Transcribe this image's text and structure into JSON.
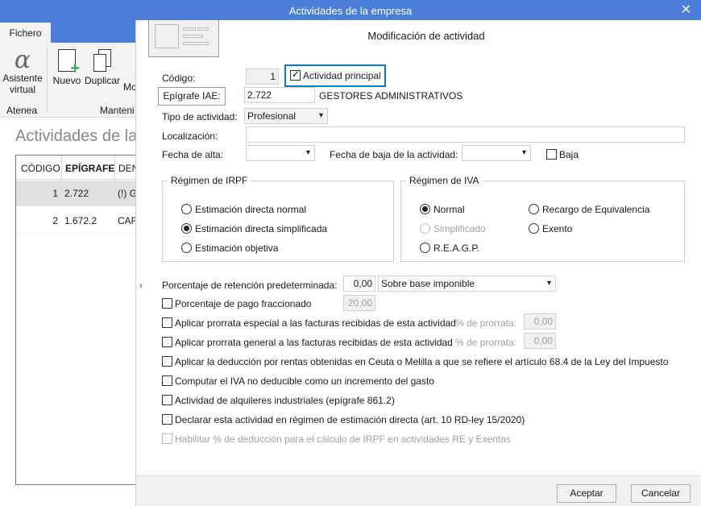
{
  "window": {
    "title": "Actividades de la empresa",
    "close": "✕"
  },
  "ribbon": {
    "tab": "Fichero",
    "asistente": "Asistente",
    "virtual": "virtual",
    "group1": "Atenea",
    "nuevo": "Nuevo",
    "duplicar": "Duplicar",
    "mod": "Mo",
    "group2": "Manteni"
  },
  "list": {
    "title": "Actividades de la",
    "headers": [
      "CÓDIGO",
      "EPÍGRAFE",
      "DEN"
    ],
    "rows": [
      {
        "codigo": "1",
        "epigrafe": "2.722",
        "den": "(!) G"
      },
      {
        "codigo": "2",
        "epigrafe": "1.672.2",
        "den": "CAF"
      }
    ]
  },
  "dialog": {
    "title": "Modificación de actividad",
    "codigo_label": "Código:",
    "codigo": "1",
    "principal": "Actividad principal",
    "principal_checked": true,
    "epigrafe_btn": "Epígrafe IAE:",
    "epigrafe": "2.722",
    "epigrafe_desc": "GESTORES ADMINISTRATIVOS",
    "tipo_label": "Tipo de actividad:",
    "tipo": "Profesional",
    "loc_label": "Localización:",
    "loc": "",
    "alta_label": "Fecha de alta:",
    "baja_label": "Fecha de baja de la actividad:",
    "baja_cb": "Baja",
    "irpf": {
      "legend": "Régimen de IRPF",
      "options": [
        "Estimación directa normal",
        "Estimación directa simplificada",
        "Estimación objetiva"
      ],
      "selected": 1
    },
    "iva": {
      "legend": "Régimen de IVA",
      "normal": "Normal",
      "simplificado": "Simplificado",
      "reagp": "R.E.A.G.P.",
      "recargo": "Recargo de Equivalencia",
      "exento": "Exento",
      "selected": "Normal"
    },
    "retencion_label": "Porcentaje de retención predeterminada:",
    "retencion": "0,00",
    "retencion_base": "Sobre base imponible",
    "fraccionado": "Porcentaje de pago fraccionado",
    "fraccionado_val": "20,00",
    "prorrata_esp": "Aplicar prorrata especial a las facturas recibidas de esta actividad",
    "prorrata_label": "% de prorrata:",
    "prorrata_esp_val": "0,00",
    "prorrata_gen": "Aplicar prorrata general a las facturas recibidas de esta actividad",
    "prorrata_gen_val": "0,00",
    "ceuta": "Aplicar la deducción por rentas obtenidas en Ceuta o Melilla a que se refiere el artículo 68.4 de la Ley del Impuesto",
    "computar": "Computar el IVA no deducible como un incremento del gasto",
    "alquileres": "Actividad de alquileres industriales (epígrafe 861.2)",
    "declarar": "Declarar esta actividad en régimen de estimación directa (art. 10 RD-ley 15/2020)",
    "habilitar": "Habilitar % de deducción para el cálculo de IRPF en actividades RE y Exentas",
    "aceptar": "Aceptar",
    "cancelar": "Cancelar"
  },
  "colors": {
    "titlebar": "#4b7ed8",
    "focus": "#0a7ac4",
    "add": "#2aa84a"
  }
}
